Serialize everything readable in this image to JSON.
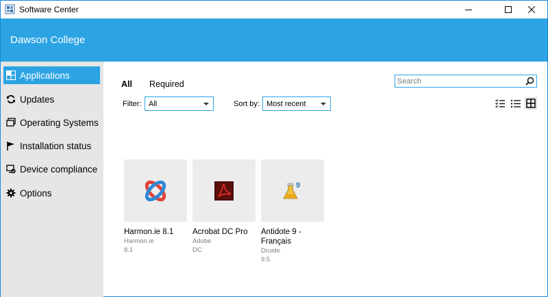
{
  "window": {
    "title": "Software Center",
    "controls": {
      "minimize_icon": "minimize-icon",
      "maximize_icon": "maximize-icon",
      "close_icon": "close-icon"
    }
  },
  "header": {
    "organization": "Dawson College"
  },
  "sidebar": {
    "items": [
      {
        "label": "Applications",
        "icon": "grid-icon",
        "active": true
      },
      {
        "label": "Updates",
        "icon": "refresh-icon",
        "active": false
      },
      {
        "label": "Operating Systems",
        "icon": "windows-stack-icon",
        "active": false
      },
      {
        "label": "Installation status",
        "icon": "flag-icon",
        "active": false
      },
      {
        "label": "Device compliance",
        "icon": "compliance-check-icon",
        "active": false
      },
      {
        "label": "Options",
        "icon": "gear-icon",
        "active": false
      }
    ]
  },
  "main": {
    "tabs": [
      {
        "label": "All",
        "selected": true
      },
      {
        "label": "Required",
        "selected": false
      }
    ],
    "search": {
      "placeholder": "Search",
      "value": ""
    },
    "filter": {
      "label": "Filter:",
      "selected": "All"
    },
    "sort": {
      "label": "Sort by:",
      "selected": "Most recent"
    },
    "view_modes": [
      "checklist-view-icon",
      "list-view-icon",
      "tile-view-icon"
    ],
    "active_view": "tile-view-icon",
    "apps": [
      {
        "name": "Harmon.ie 8.1",
        "publisher": "Harmon.ie",
        "version": "8.1",
        "icon": "harmonie-logo-icon"
      },
      {
        "name": "Acrobat DC Pro",
        "publisher": "Adobe",
        "version": "DC",
        "icon": "acrobat-logo-icon"
      },
      {
        "name": "Antidote 9 - Français",
        "publisher": "Druide",
        "version": "9.5",
        "icon": "antidote-logo-icon"
      }
    ]
  },
  "colors": {
    "accent": "#2ca4e4",
    "sidebar_bg": "#e6e6e6",
    "tile_bg": "#ececec"
  }
}
